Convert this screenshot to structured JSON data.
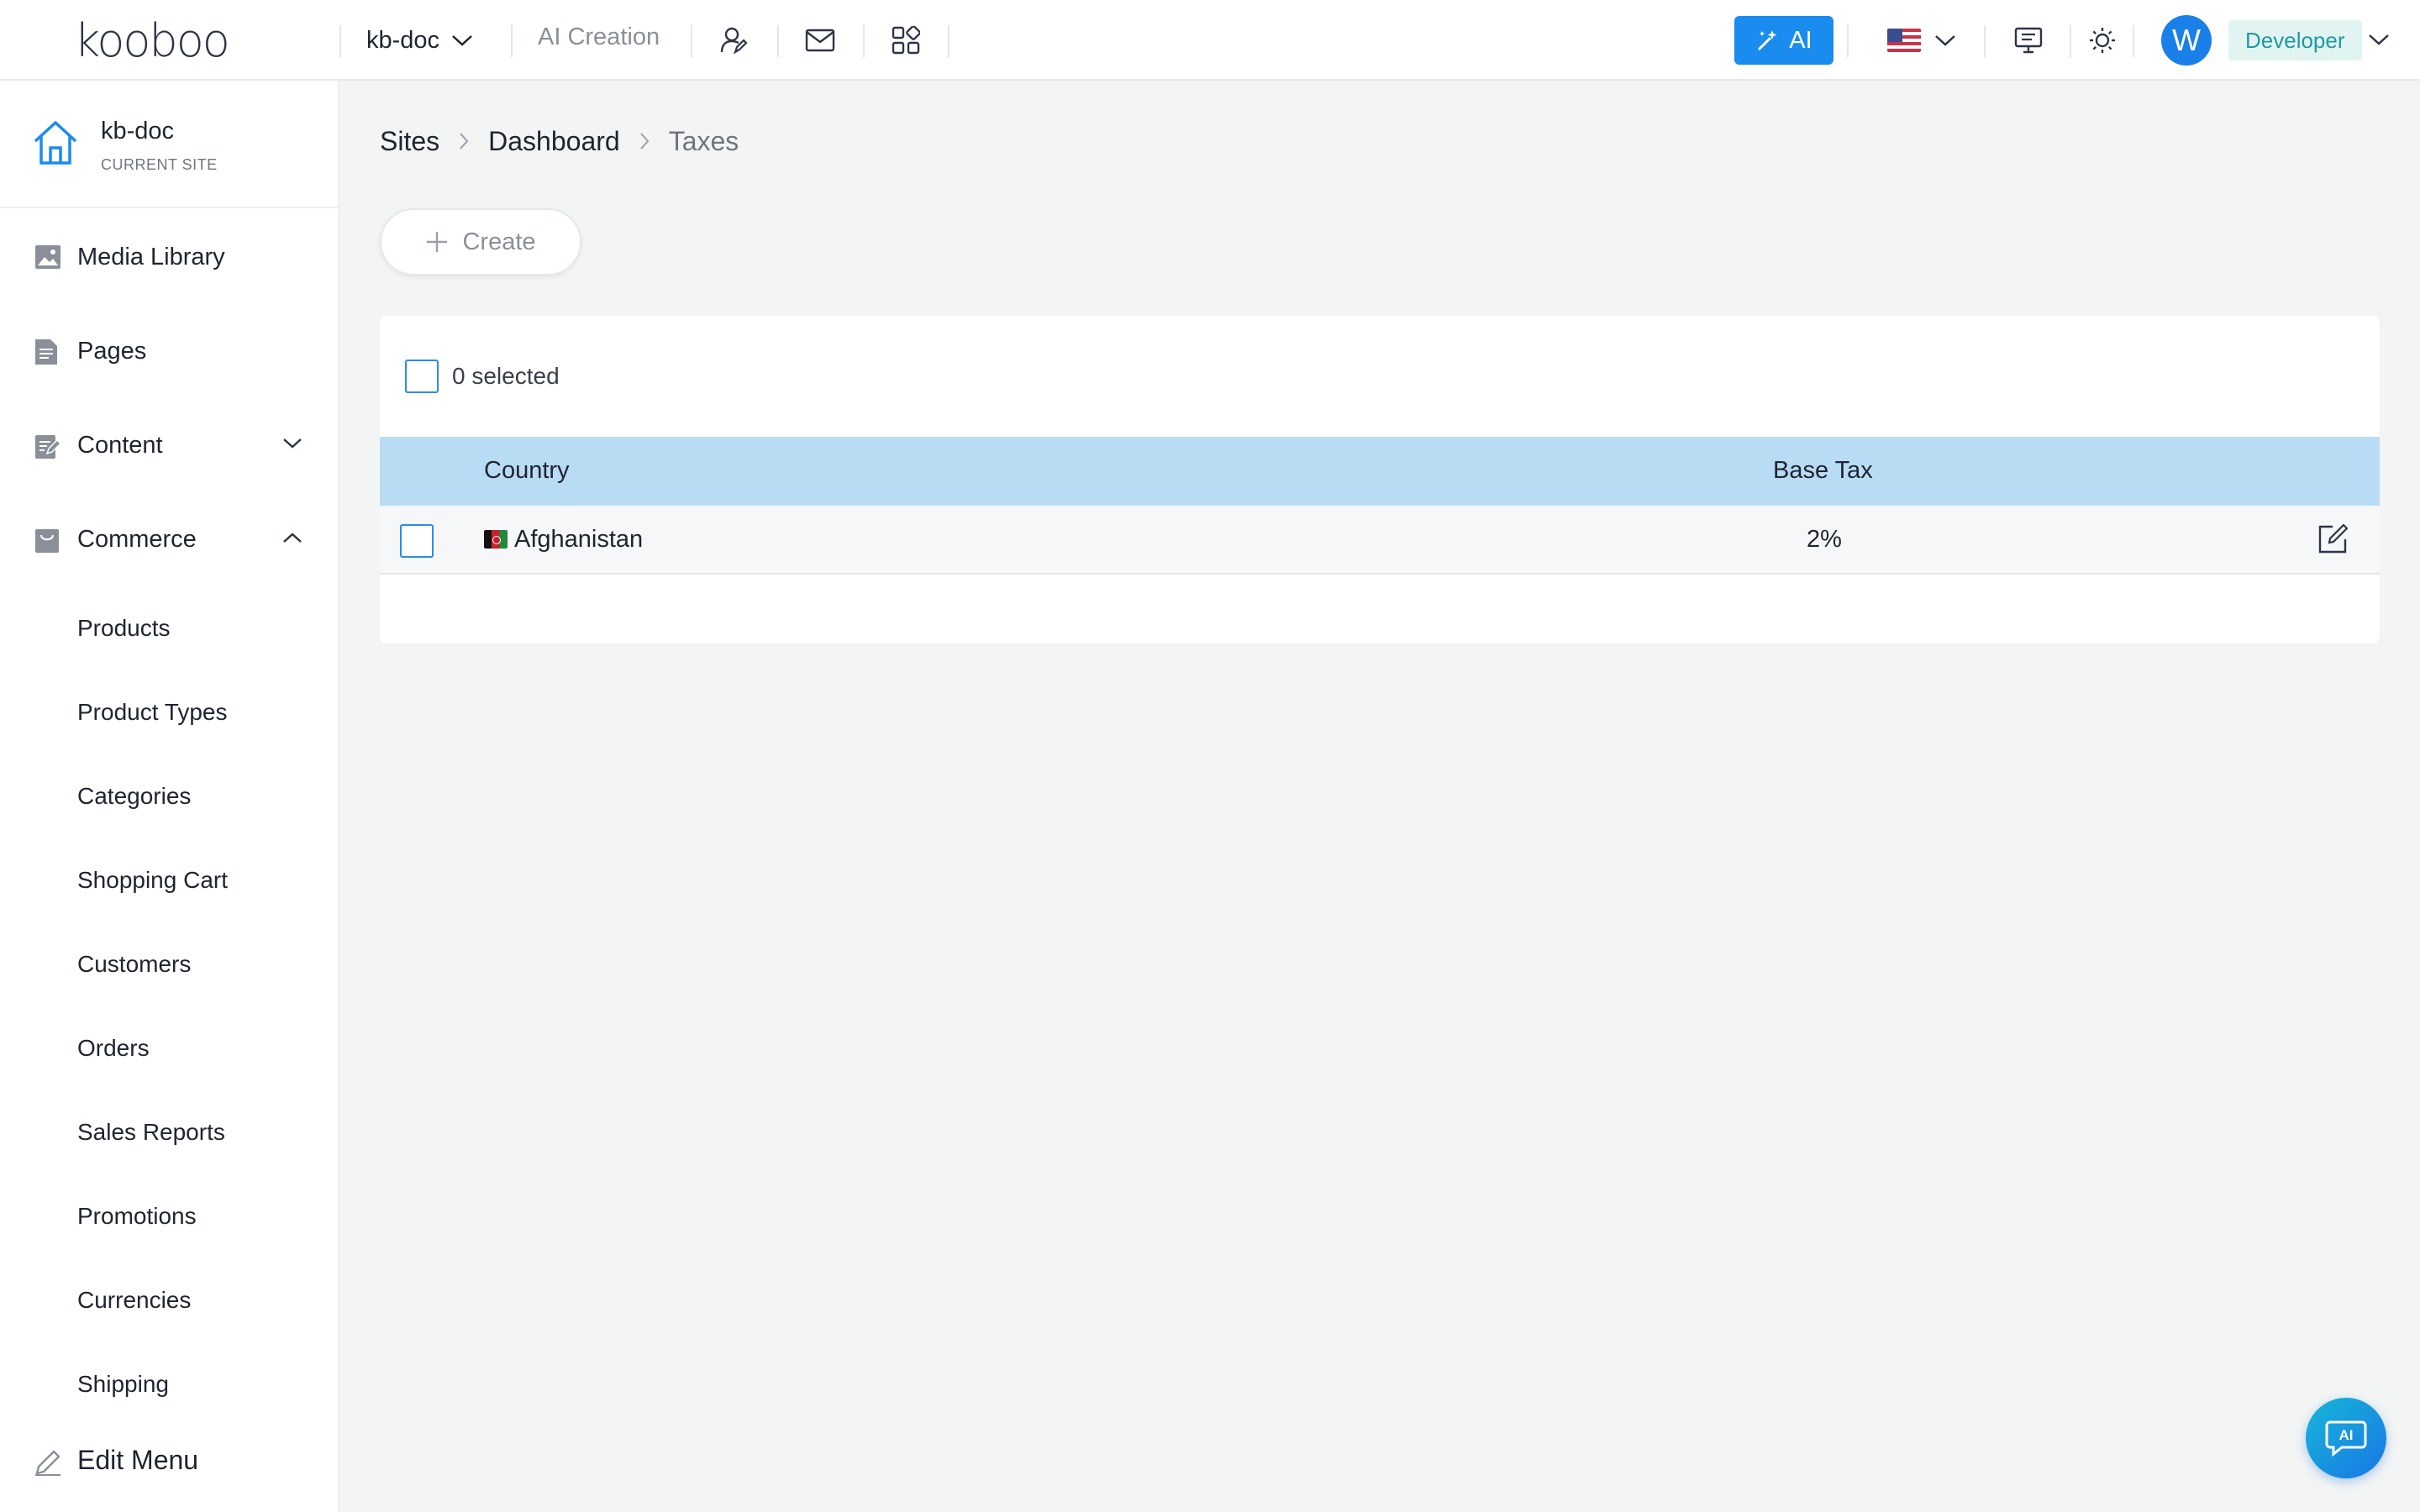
{
  "brand": {
    "logo_text": "kooboo"
  },
  "header": {
    "site_name": "kb-doc",
    "ai_creation": "AI Creation",
    "ai_button": "AI",
    "avatar_initial": "W",
    "role": "Developer",
    "icons": [
      "user-edit-icon",
      "mail-icon",
      "apps-grid-icon",
      "monitor-icon",
      "sun-icon"
    ]
  },
  "sidebar": {
    "current_site": {
      "name": "kb-doc",
      "label": "CURRENT SITE"
    },
    "items": [
      {
        "label": "Media Library",
        "icon": "image-icon"
      },
      {
        "label": "Pages",
        "icon": "page-icon"
      },
      {
        "label": "Content",
        "icon": "content-icon",
        "expanded": false
      },
      {
        "label": "Commerce",
        "icon": "commerce-icon",
        "expanded": true
      }
    ],
    "commerce_children": [
      "Products",
      "Product Types",
      "Categories",
      "Shopping Cart",
      "Customers",
      "Orders",
      "Sales Reports",
      "Promotions",
      "Currencies",
      "Shipping"
    ],
    "edit_menu": "Edit Menu"
  },
  "breadcrumb": [
    "Sites",
    "Dashboard",
    "Taxes"
  ],
  "toolbar": {
    "create_label": "Create"
  },
  "table": {
    "selected_text": "0 selected",
    "columns": [
      "Country",
      "Base Tax"
    ],
    "rows": [
      {
        "country": "Afghanistan",
        "base_tax": "2%"
      }
    ]
  },
  "fab": {
    "label": "AI"
  },
  "colors": {
    "accent": "#1a8cf0",
    "header_row": "#b9dcf5",
    "role_badge": "#e2f4f2"
  }
}
